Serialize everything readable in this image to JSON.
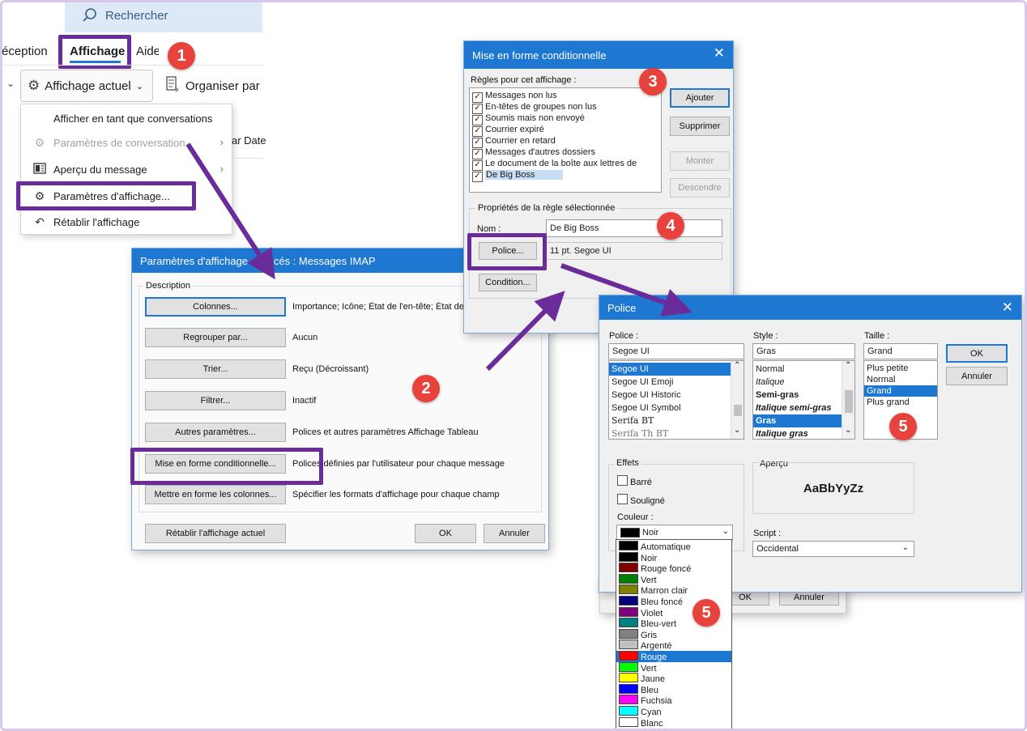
{
  "outlook": {
    "search_placeholder": "Rechercher",
    "tabs": [
      "éception",
      "Affichage",
      "Aide"
    ],
    "current_view_label": "Affichage actuel",
    "organize_label": "Organiser par",
    "by_date_hint": "ar Date",
    "menu": [
      {
        "label": "Afficher en tant que conversations",
        "icon": "none",
        "enabled": true
      },
      {
        "label": "Paramètres de conversation",
        "icon": "conversation-settings-icon",
        "enabled": false,
        "submenu": true
      },
      {
        "label": "Aperçu du message",
        "icon": "reading-pane-icon",
        "enabled": true,
        "submenu": true
      },
      {
        "label": "Paramètres d'affichage...",
        "icon": "gear-icon",
        "enabled": true
      },
      {
        "label": "Rétablir l'affichage",
        "icon": "undo-icon",
        "enabled": true
      }
    ]
  },
  "badges": [
    "1",
    "2",
    "3",
    "4",
    "5",
    "5"
  ],
  "advanced_view": {
    "title": "Paramètres d'affichage avancés : Messages IMAP",
    "group_label": "Description",
    "rows": [
      {
        "button": "Colonnes...",
        "desc": "Importance; Icône; État de l'en-tête; État de"
      },
      {
        "button": "Regrouper par...",
        "desc": "Aucun"
      },
      {
        "button": "Trier...",
        "desc": "Reçu (Décroissant)"
      },
      {
        "button": "Filtrer...",
        "desc": "Inactif"
      },
      {
        "button": "Autres paramètres...",
        "desc": "Polices et autres paramètres Affichage Tableau"
      },
      {
        "button": "Mise en forme conditionnelle...",
        "desc": "Polices définies par l'utilisateur pour chaque message"
      },
      {
        "button": "Mettre en forme les colonnes...",
        "desc": "Spécifier les formats d'affichage pour chaque champ"
      }
    ],
    "reset_button": "Rétablir l'affichage actuel",
    "ok_button": "OK",
    "cancel_button": "Annuler"
  },
  "conditional": {
    "title": "Mise en forme conditionnelle",
    "rules_label": "Règles pour cet affichage :",
    "rules": [
      {
        "label": "Messages non lus",
        "checked": true,
        "selected": false
      },
      {
        "label": "En-têtes de groupes non lus",
        "checked": true,
        "selected": false
      },
      {
        "label": "Soumis mais non envoyé",
        "checked": true,
        "selected": false
      },
      {
        "label": "Courrier expiré",
        "checked": true,
        "selected": false
      },
      {
        "label": "Courrier en retard",
        "checked": true,
        "selected": false
      },
      {
        "label": "Messages d'autres dossiers",
        "checked": true,
        "selected": false
      },
      {
        "label": "Le document de la boîte aux lettres de",
        "checked": true,
        "selected": false
      },
      {
        "label": "De Big Boss",
        "checked": true,
        "selected": true
      }
    ],
    "add_button": "Ajouter",
    "delete_button": "Supprimer",
    "up_button": "Monter",
    "down_button": "Descendre",
    "props_label": "Propriétés de la règle sélectionnée",
    "name_label": "Nom :",
    "name_value": "De Big Boss",
    "font_button": "Police...",
    "font_value": "11 pt. Segoe UI",
    "condition_button": "Condition..."
  },
  "font_dialog": {
    "title": "Police",
    "font_label": "Police :",
    "font_value": "Segoe UI",
    "fonts": [
      "Segoe UI",
      "Segoe UI Emoji",
      "Segoe UI Historic",
      "Segoe UI Symbol",
      "Serifa BT",
      "Serifa Th BT"
    ],
    "selected_font": "Segoe UI",
    "style_label": "Style :",
    "style_value": "Gras",
    "styles": [
      "Normal",
      "Italique",
      "Semi-gras",
      "Italique semi-gras",
      "Gras",
      "Italique gras"
    ],
    "selected_style": "Gras",
    "size_label": "Taille :",
    "size_value": "Grand",
    "sizes": [
      "Plus petite",
      "Normal",
      "Grand",
      "Plus grand"
    ],
    "selected_size": "Grand",
    "ok_button": "OK",
    "cancel_button": "Annuler",
    "effects_label": "Effets",
    "strike_label": "Barré",
    "underline_label": "Souligné",
    "color_label": "Couleur :",
    "color_value": "Noir",
    "preview_label": "Aperçu",
    "preview_text": "AaBbYyZz",
    "script_label": "Script :",
    "script_value": "Occidental",
    "colors": [
      {
        "name": "Automatique",
        "hex": "#000000"
      },
      {
        "name": "Noir",
        "hex": "#000000"
      },
      {
        "name": "Rouge foncé",
        "hex": "#800000"
      },
      {
        "name": "Vert",
        "hex": "#008000"
      },
      {
        "name": "Marron clair",
        "hex": "#808000"
      },
      {
        "name": "Bleu foncé",
        "hex": "#000080"
      },
      {
        "name": "Violet",
        "hex": "#800080"
      },
      {
        "name": "Bleu-vert",
        "hex": "#008080"
      },
      {
        "name": "Gris",
        "hex": "#808080"
      },
      {
        "name": "Argenté",
        "hex": "#c0c0c0"
      },
      {
        "name": "Rouge",
        "hex": "#ff0000"
      },
      {
        "name": "Vert",
        "hex": "#00ff00"
      },
      {
        "name": "Jaune",
        "hex": "#ffff00"
      },
      {
        "name": "Bleu",
        "hex": "#0000ff"
      },
      {
        "name": "Fuchsia",
        "hex": "#ff00ff"
      },
      {
        "name": "Cyan",
        "hex": "#00ffff"
      },
      {
        "name": "Blanc",
        "hex": "#ffffff"
      }
    ],
    "selected_color": "Rouge",
    "behind_ok": "OK",
    "behind_cancel": "Annuler"
  },
  "colors": {
    "accent": "#1e78d2",
    "highlight": "#6a2c9a",
    "badge": "#e8423c"
  }
}
